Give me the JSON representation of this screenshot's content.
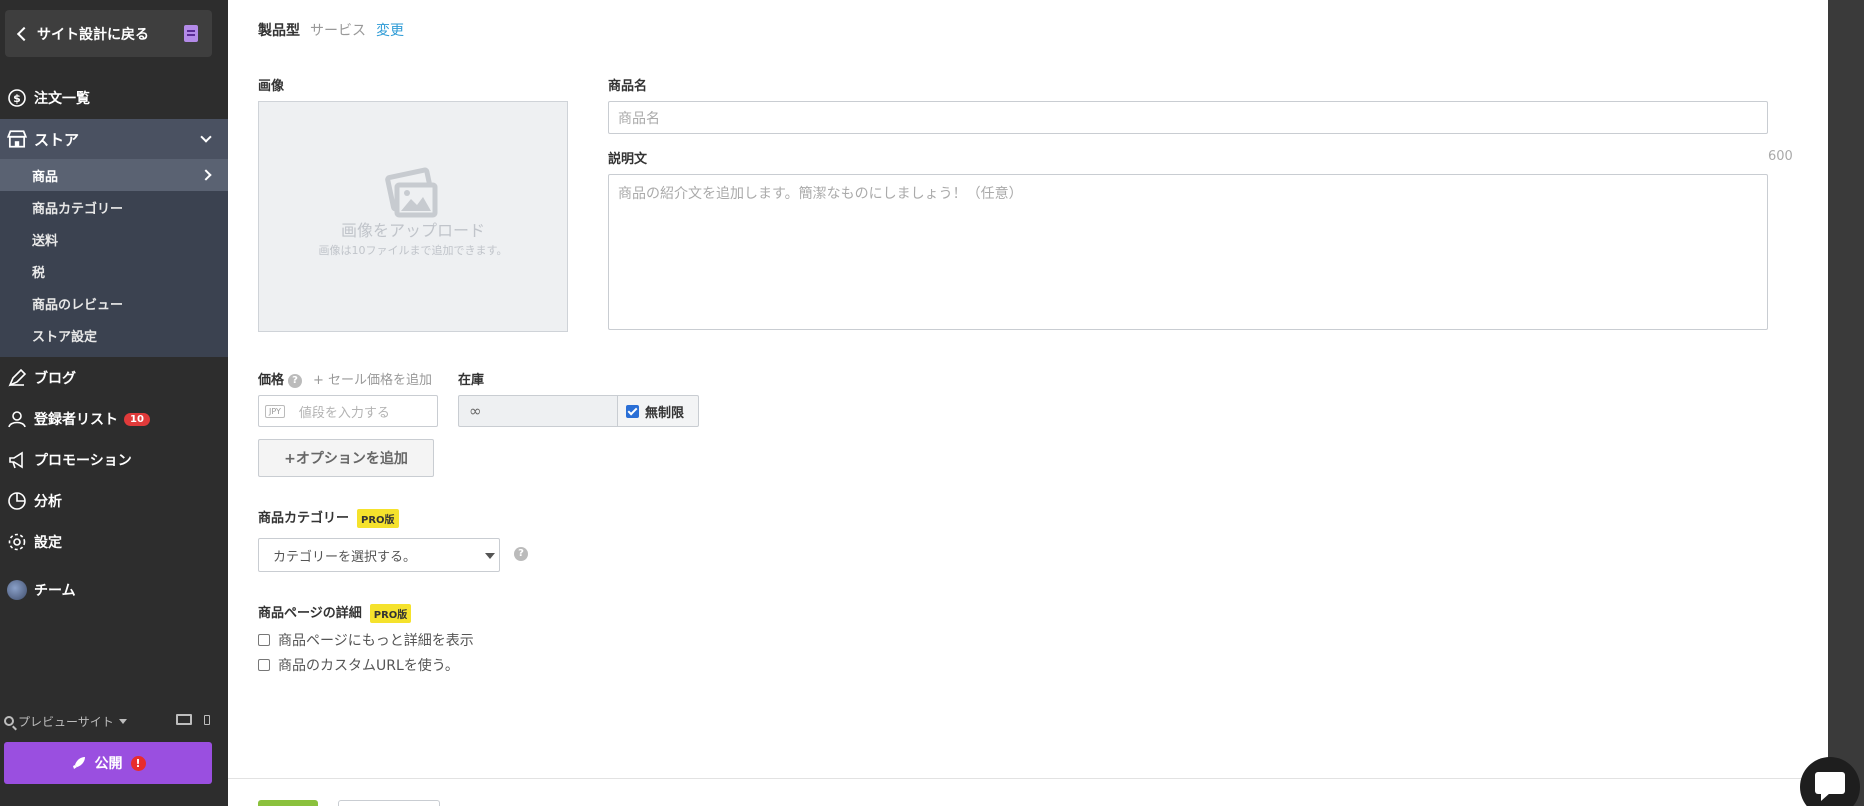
{
  "sidebar": {
    "back_label": "サイト設計に戻る",
    "items": {
      "orders": "注文一覧",
      "store": "ストア",
      "blog": "ブログ",
      "subscribers": "登録者リスト",
      "subscribers_badge": "10",
      "promotion": "プロモーション",
      "analytics": "分析",
      "settings": "設定",
      "team": "チーム"
    },
    "store_sub": {
      "products": "商品",
      "categories": "商品カテゴリー",
      "shipping": "送料",
      "tax": "税",
      "reviews": "商品のレビュー",
      "store_settings": "ストア設定"
    },
    "preview_label": "プレビューサイト",
    "publish_label": "公開",
    "publish_alert": "!"
  },
  "product_type": {
    "current": "製品型",
    "other": "サービス",
    "change": "変更"
  },
  "image": {
    "label": "画像",
    "upload_title": "画像をアップロード",
    "upload_hint": "画像は10ファイルまで追加できます。"
  },
  "name": {
    "label": "商品名",
    "placeholder": "商品名"
  },
  "description": {
    "label": "説明文",
    "char_count": "600",
    "placeholder": "商品の紹介文を追加します。簡潔なものにしましょう！（任意）"
  },
  "price": {
    "label": "価格",
    "help": "?",
    "sale_link": "+ セール価格を追加",
    "currency": "JPY",
    "placeholder": "値段を入力する"
  },
  "stock": {
    "label": "在庫",
    "value": "∞",
    "unlimited_label": "無制限"
  },
  "add_option_label": "+オプションを追加",
  "category": {
    "label": "商品カテゴリー",
    "pro": "PRO版",
    "selected": "カテゴリーを選択する。",
    "help": "?"
  },
  "details": {
    "label": "商品ページの詳細",
    "pro": "PRO版",
    "option_more": "商品ページにもっと詳細を表示",
    "option_url": "商品のカスタムURLを使う。"
  },
  "colors": {
    "sidebar_bg": "#2d2d2d",
    "store_group_bg": "#3b4250",
    "publish": "#9a4fe0",
    "link": "#2e9bd6",
    "pro_badge": "#f5e22c",
    "save": "#8bc13d",
    "alert": "#e03a3a"
  }
}
